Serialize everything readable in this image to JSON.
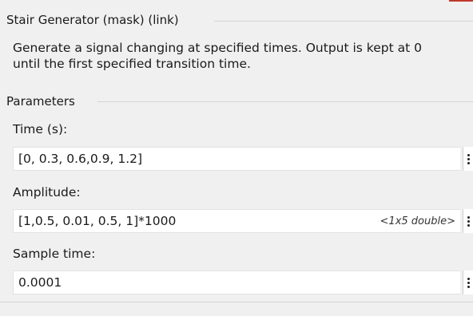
{
  "block": {
    "title": "Stair Generator (mask) (link)",
    "description_line1": "Generate a signal changing at specified times. Output is kept at 0",
    "description_line2": "until the first specified transition time."
  },
  "parameters": {
    "group_title": "Parameters",
    "time": {
      "label": "Time (s):",
      "value": "[0, 0.3, 0.6,0.9, 1.2]"
    },
    "amplitude": {
      "label": "Amplitude:",
      "value": "[1,0.5, 0.01, 0.5, 1]*1000",
      "hint": "<1x5 double>"
    },
    "sample_time": {
      "label": "Sample time:",
      "value": "0.0001"
    }
  },
  "icons": {
    "field_menu": "kebab-menu-icon"
  },
  "colors": {
    "background": "#f0f0f0",
    "field_background": "#ffffff",
    "accent_mark": "#c0392b"
  }
}
